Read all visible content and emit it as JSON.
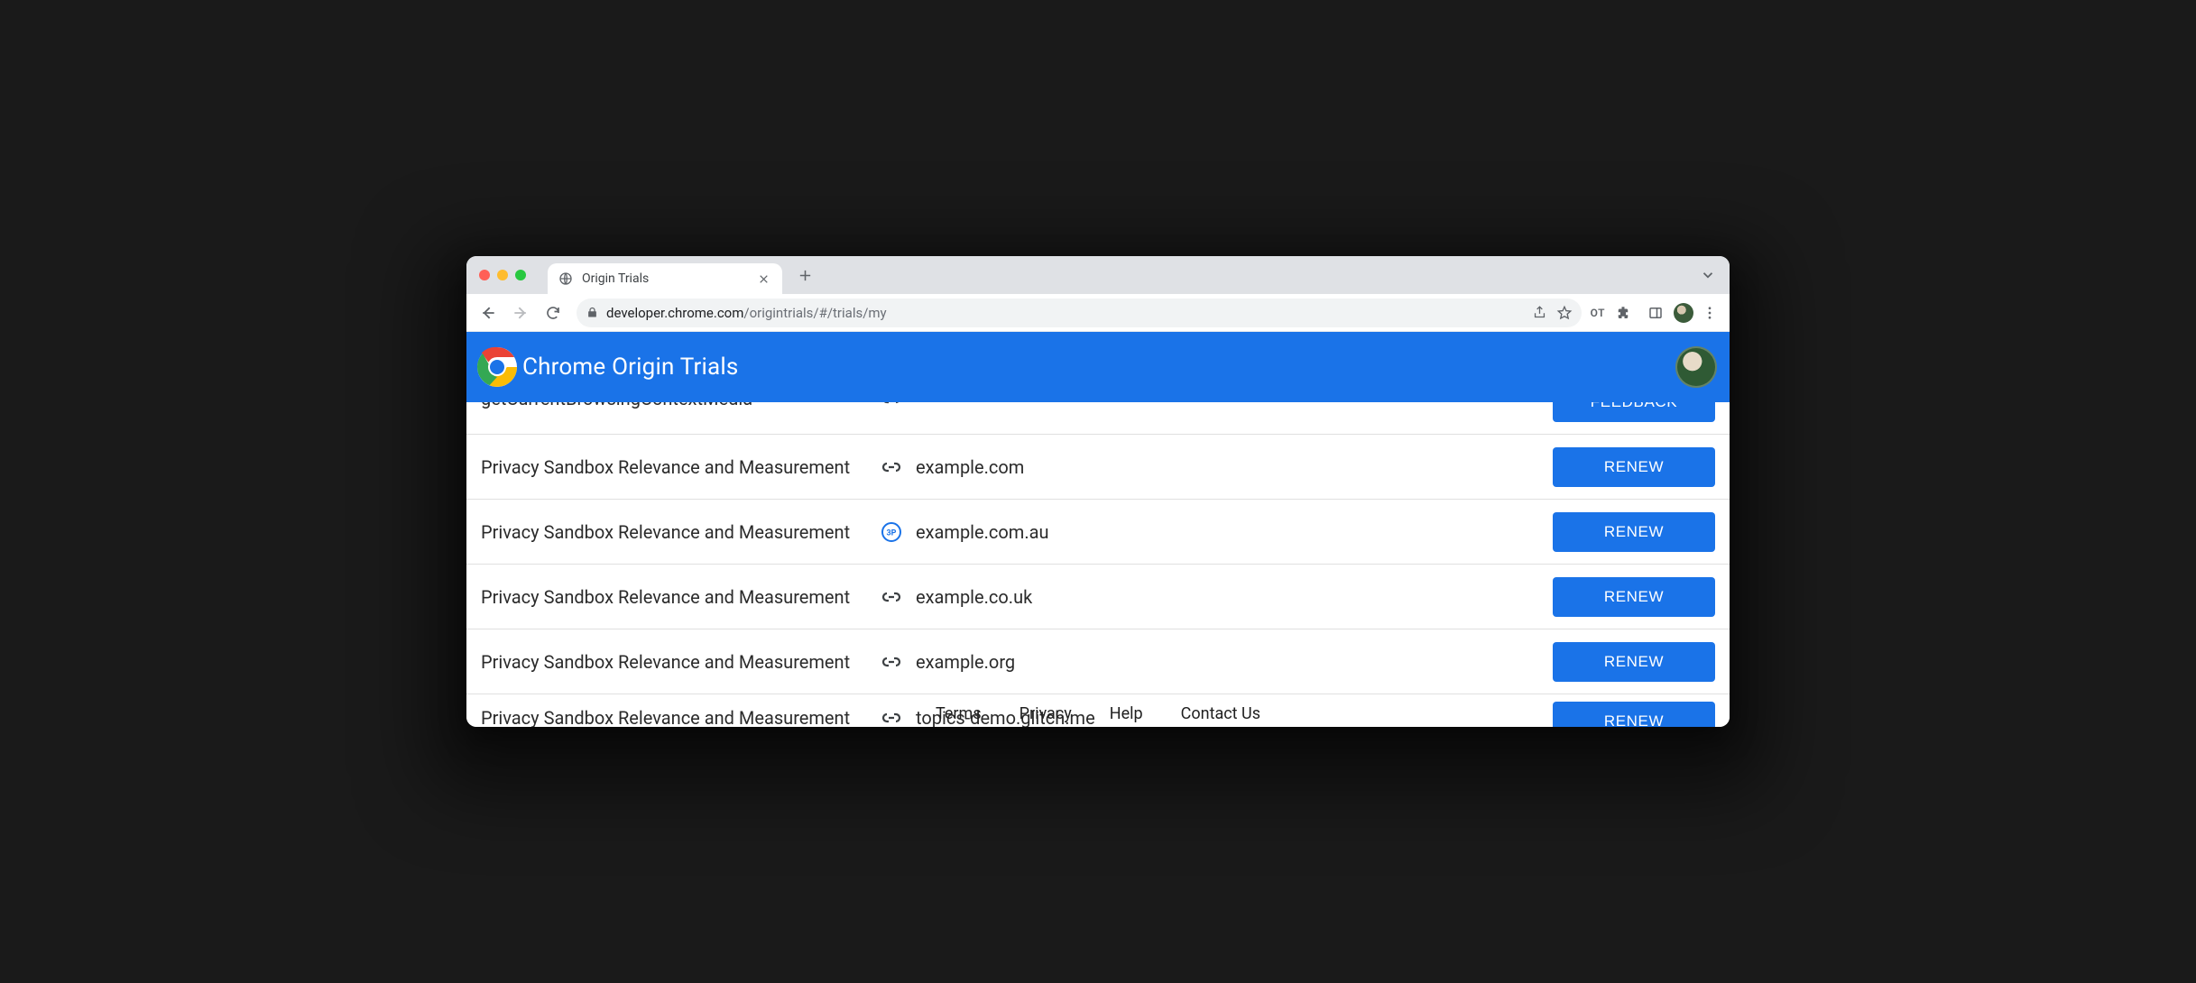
{
  "tab": {
    "title": "Origin Trials"
  },
  "omnibox": {
    "host": "developer.chrome.com",
    "path": "/origintrials/#/trials/my",
    "pill": "OT"
  },
  "site": {
    "title": "Chrome Origin Trials"
  },
  "rows": [
    {
      "trial": "getCurrentBrowsingContextMedia",
      "origin": "",
      "icon": "link",
      "action": "FEEDBACK"
    },
    {
      "trial": "Privacy Sandbox Relevance and Measurement",
      "origin": "example.com",
      "icon": "link",
      "action": "RENEW"
    },
    {
      "trial": "Privacy Sandbox Relevance and Measurement",
      "origin": "example.com.au",
      "icon": "3p",
      "action": "RENEW"
    },
    {
      "trial": "Privacy Sandbox Relevance and Measurement",
      "origin": "example.co.uk",
      "icon": "link",
      "action": "RENEW"
    },
    {
      "trial": "Privacy Sandbox Relevance and Measurement",
      "origin": "example.org",
      "icon": "link",
      "action": "RENEW"
    },
    {
      "trial": "Privacy Sandbox Relevance and Measurement",
      "origin": "topics-demo.glitch.me",
      "icon": "link",
      "action": "RENEW"
    }
  ],
  "footer": {
    "terms": "Terms",
    "privacy": "Privacy",
    "help": "Help",
    "contact": "Contact Us"
  }
}
